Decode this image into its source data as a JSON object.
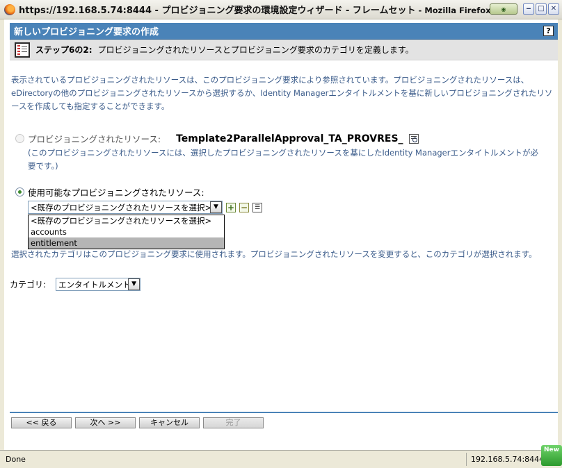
{
  "window": {
    "title": "https://192.168.5.74:8444 - プロビジョニング要求の環境設定ウィザード - フレームセット",
    "title_suffix": " - Mozilla Firefox",
    "controls": {
      "minimize": "‒",
      "maximize": "□",
      "close": "✕"
    }
  },
  "header": {
    "title": "新しいプロビジョニング要求の作成",
    "help": "?"
  },
  "step": {
    "label": "ステップ6の2:",
    "description": "プロビジョニングされたリソースとプロビジョニング要求のカテゴリを定義します。"
  },
  "intro_text": "表示されているプロビジョニングされたリソースは、このプロビジョニング要求により参照されています。プロビジョニングされたリソースは、eDirectoryの他のプロビジョニングされたリソースから選択するか、Identity Managerエンタイトルメントを基に新しいプロビジョニングされたリソースを作成しても指定することができます。",
  "option_resource": {
    "label": "プロビジョニングされたリソース:",
    "value": "Template2ParallelApproval_TA_PROVRES_",
    "note": "(このプロビジョニングされたリソースには、選択したプロビジョニングされたリソースを基にしたIdentity Managerエンタイトルメントが必要です。)",
    "checked": false
  },
  "option_available": {
    "label": "使用可能なプロビジョニングされたリソース:",
    "checked": true,
    "select_value": "<既存のプロビジョニングされたリソースを選択>",
    "options": [
      "<既存のプロビジョニングされたリソースを選択>",
      "accounts",
      "entitlement"
    ],
    "highlighted_option": "entitlement"
  },
  "category_note": "選択されたカテゴリはこのプロビジョニング要求に使用されます。プロビジョニングされたリソースを変更すると、このカテゴリが選択されます。",
  "category": {
    "label": "カテゴリ:",
    "value": "エンタイトルメント"
  },
  "buttons": {
    "back": "<< 戻る",
    "next": "次へ >>",
    "cancel": "キャンセル",
    "finish": "完了"
  },
  "statusbar": {
    "status": "Done",
    "host": "192.168.5.74:8444",
    "badge": "New"
  },
  "colors": {
    "header_blue": "#4a83b8",
    "text_blue": "#3a5b8a",
    "radio_green": "#3c8a2e"
  }
}
